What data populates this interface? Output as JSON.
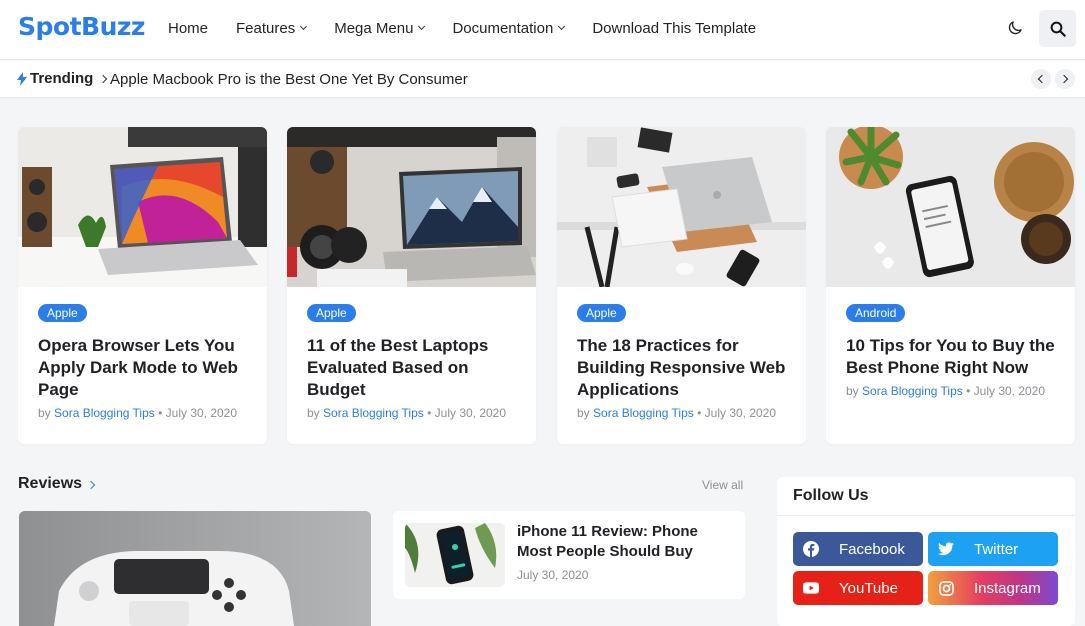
{
  "header": {
    "logo": "SpotBuzz",
    "nav": [
      {
        "label": "Home",
        "dropdown": false
      },
      {
        "label": "Features",
        "dropdown": true
      },
      {
        "label": "Mega Menu",
        "dropdown": true
      },
      {
        "label": "Documentation",
        "dropdown": true
      },
      {
        "label": "Download This Template",
        "dropdown": false
      }
    ],
    "icons": {
      "theme": "moon-icon",
      "search": "search-icon"
    }
  },
  "trending": {
    "label": "Trending",
    "headline": "Apple Macbook Pro is the Best One Yet By Consumer"
  },
  "posts": [
    {
      "category": "Apple",
      "title": "Opera Browser Lets You Apply Dark Mode to Web Page",
      "by": "by",
      "author": "Sora Blogging Tips",
      "date": "• July 30, 2020"
    },
    {
      "category": "Apple",
      "title": "11 of the Best Laptops Evaluated Based on Budget",
      "by": "by",
      "author": "Sora Blogging Tips",
      "date": "• July 30, 2020"
    },
    {
      "category": "Apple",
      "title": "The 18 Practices for Building Responsive Web Applications",
      "by": "by",
      "author": "Sora Blogging Tips",
      "date": "• July 30, 2020"
    },
    {
      "category": "Android",
      "title": "10 Tips for You to Buy the Best Phone Right Now",
      "by": "by",
      "author": "Sora Blogging Tips",
      "date": "• July 30, 2020"
    }
  ],
  "reviews": {
    "title": "Reviews",
    "view_all": "View all",
    "small": {
      "title": "iPhone 11 Review: Phone Most People Should Buy",
      "date": "July 30, 2020"
    }
  },
  "follow": {
    "title": "Follow Us",
    "networks": [
      {
        "label": "Facebook",
        "color": "#3b5998",
        "icon": "facebook-icon"
      },
      {
        "label": "Twitter",
        "color": "#1da1f2",
        "icon": "twitter-icon"
      },
      {
        "label": "YouTube",
        "color": "#e62117",
        "icon": "youtube-icon"
      },
      {
        "label": "Instagram",
        "color": "#e4405f",
        "icon": "instagram-icon"
      }
    ]
  },
  "colors": {
    "accent": "#2b7de9",
    "background": "#f4f5f7",
    "text": "#1f2125",
    "meta": "#8c8f94"
  }
}
